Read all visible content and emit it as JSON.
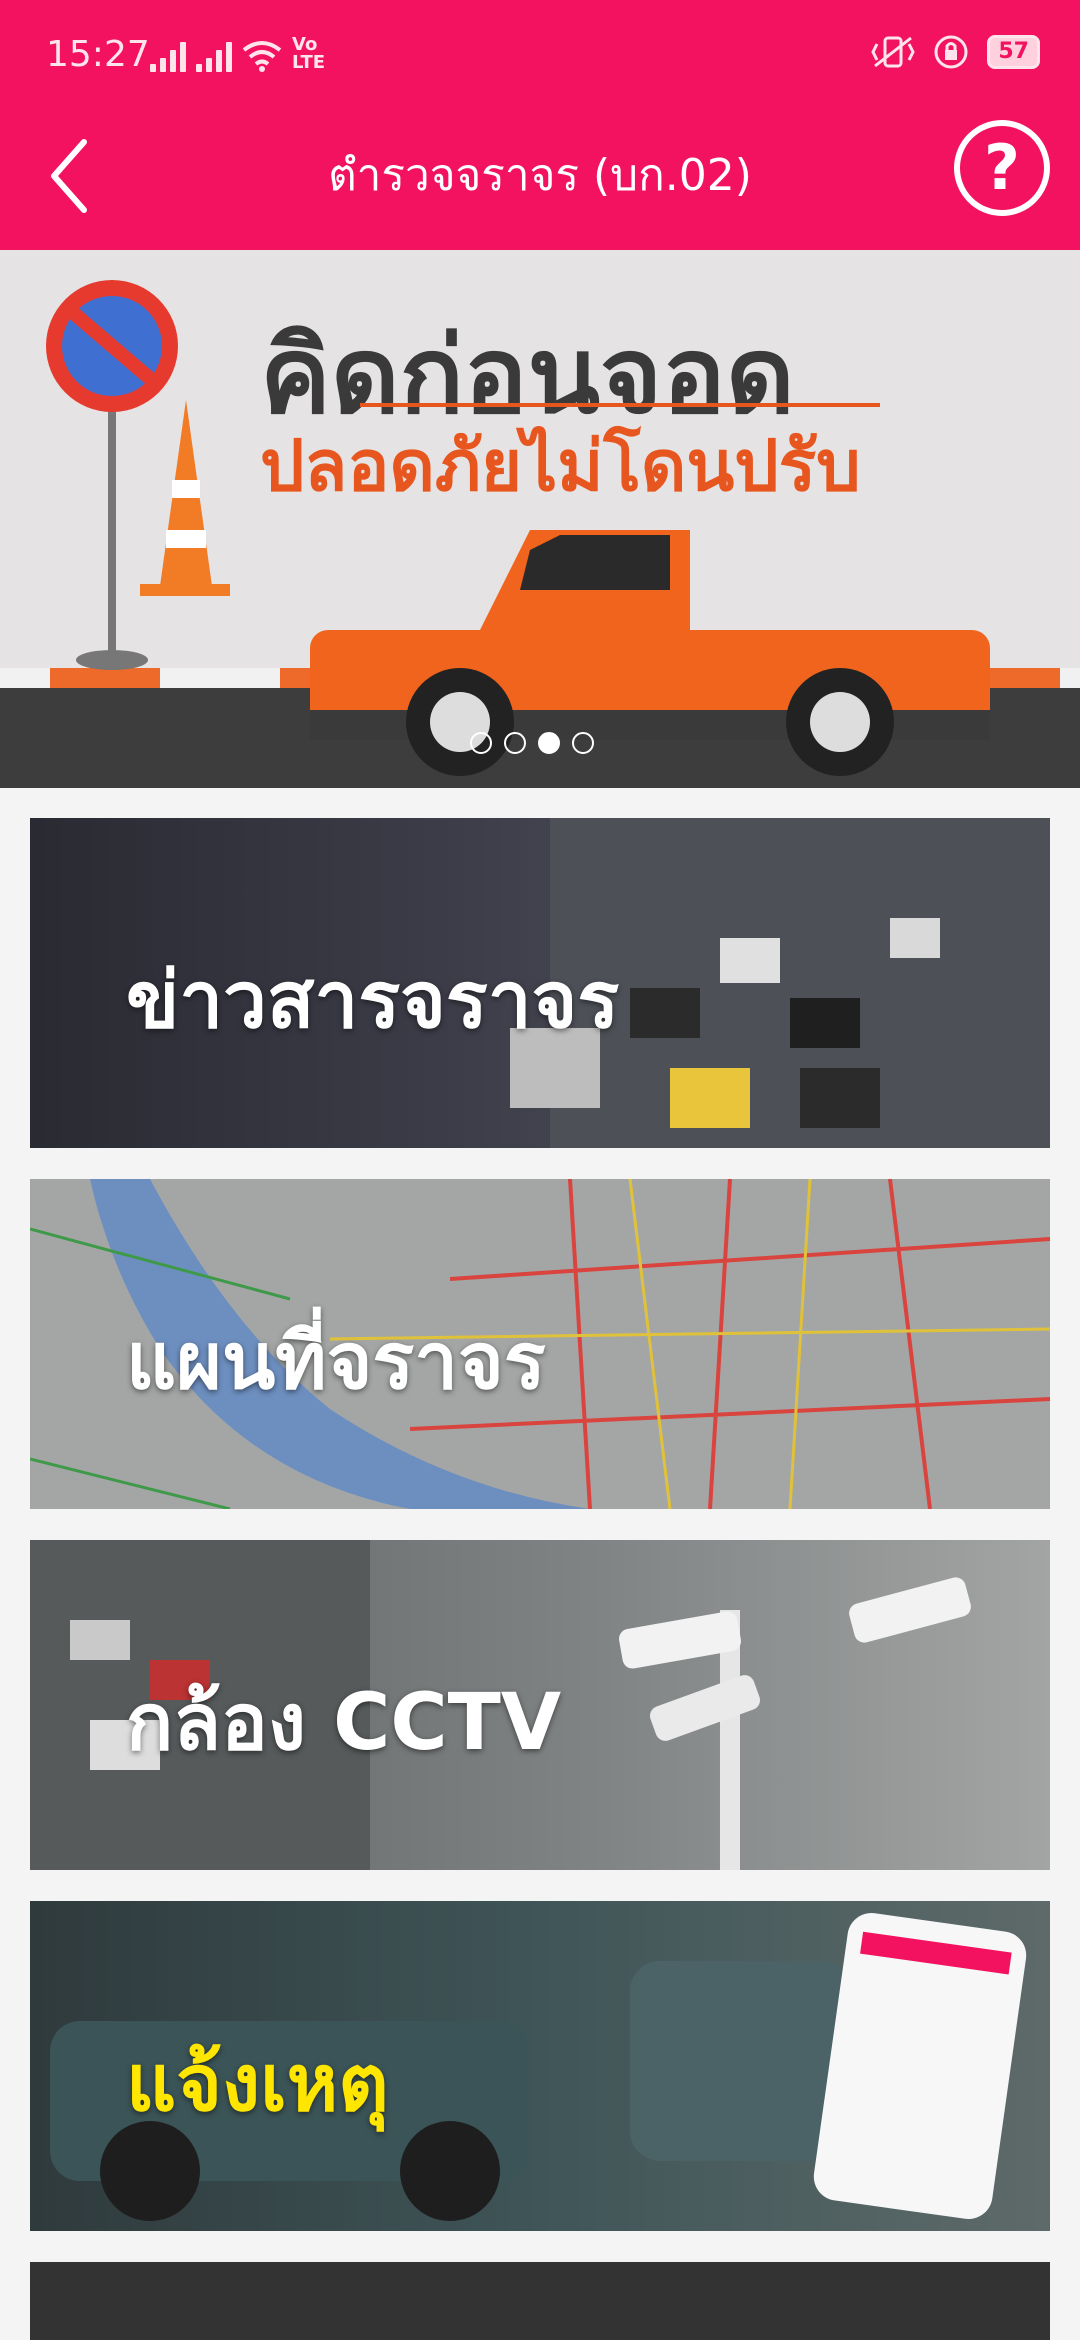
{
  "status": {
    "time": "15:27",
    "network": "Vo LTE",
    "battery": "57"
  },
  "appbar": {
    "title": "ตำรวจจราจร (บก.02)",
    "help": "?"
  },
  "banner": {
    "headline": "คิดก่อนจอด",
    "subheadline": "ปลอดภัยไม่โดนปรับ",
    "slides": 4,
    "active_slide": 3
  },
  "menu": [
    {
      "label": "ข่าวสารจราจร"
    },
    {
      "label": "แผนที่จราจร"
    },
    {
      "label": "กล้อง CCTV"
    },
    {
      "label": "แจ้งเหตุ"
    }
  ],
  "colors": {
    "brand": "#f2125f",
    "report_label": "#ffe600"
  }
}
